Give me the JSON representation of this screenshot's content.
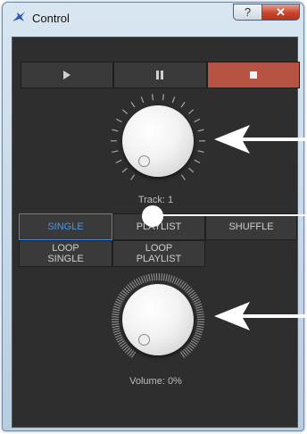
{
  "window": {
    "title": "Control",
    "help_label": "?",
    "close_label": "✕"
  },
  "transport": {
    "play_icon": "play-icon",
    "pause_icon": "pause-icon",
    "stop_icon": "stop-icon",
    "stop_color": "#b75342"
  },
  "track": {
    "label": "Track: 1"
  },
  "modes": [
    {
      "label": "SINGLE",
      "active": true
    },
    {
      "label": "PLAYLIST",
      "active": false
    },
    {
      "label": "SHUFFLE",
      "active": false
    },
    {
      "label": "LOOP\nSINGLE",
      "active": false
    },
    {
      "label": "LOOP\nPLAYLIST",
      "active": false
    }
  ],
  "volume": {
    "label": "Volume: 0%",
    "value_percent": 0
  }
}
